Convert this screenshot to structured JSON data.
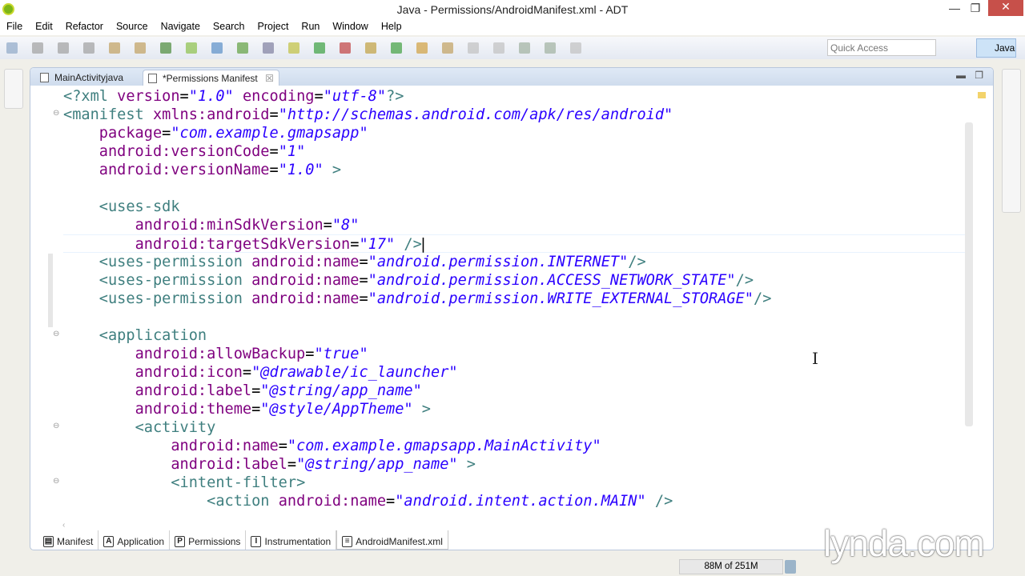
{
  "window": {
    "title": "Java - Permissions/AndroidManifest.xml - ADT",
    "minimize": "—",
    "restore": "❐",
    "close": "✕"
  },
  "menu": [
    "File",
    "Edit",
    "Refactor",
    "Source",
    "Navigate",
    "Search",
    "Project",
    "Run",
    "Window",
    "Help"
  ],
  "quick_access": {
    "placeholder": "Quick Access"
  },
  "perspective": {
    "label": "Java"
  },
  "editor_tabs": [
    {
      "label": "MainActivityjava",
      "active": false
    },
    {
      "label": "*Permissions Manifest",
      "active": true,
      "close": "☒"
    }
  ],
  "code_lines": [
    {
      "indent": 0,
      "segs": [
        [
          "pi",
          "<?xml "
        ],
        [
          "a",
          "version"
        ],
        [
          "p",
          "="
        ],
        [
          "v",
          "\"1.0\""
        ],
        [
          "p",
          " "
        ],
        [
          "a",
          "encoding"
        ],
        [
          "p",
          "="
        ],
        [
          "v",
          "\"utf-8\""
        ],
        [
          "pi",
          "?>"
        ]
      ]
    },
    {
      "indent": 0,
      "fold": true,
      "segs": [
        [
          "t",
          "<manifest "
        ],
        [
          "a",
          "xmlns:android"
        ],
        [
          "p",
          "="
        ],
        [
          "v",
          "\"http://schemas.android.com/apk/res/android\""
        ]
      ]
    },
    {
      "indent": 1,
      "segs": [
        [
          "a",
          "package"
        ],
        [
          "p",
          "="
        ],
        [
          "v",
          "\"com.example.gmapsapp\""
        ]
      ]
    },
    {
      "indent": 1,
      "segs": [
        [
          "a",
          "android:versionCode"
        ],
        [
          "p",
          "="
        ],
        [
          "v",
          "\"1\""
        ]
      ]
    },
    {
      "indent": 1,
      "segs": [
        [
          "a",
          "android:versionName"
        ],
        [
          "p",
          "="
        ],
        [
          "v",
          "\"1.0\""
        ],
        [
          "t",
          " >"
        ]
      ]
    },
    {
      "indent": 0,
      "segs": []
    },
    {
      "indent": 1,
      "segs": [
        [
          "t",
          "<uses-sdk"
        ]
      ]
    },
    {
      "indent": 2,
      "segs": [
        [
          "a",
          "android:minSdkVersion"
        ],
        [
          "p",
          "="
        ],
        [
          "v",
          "\"8\""
        ]
      ]
    },
    {
      "indent": 2,
      "current": true,
      "segs": [
        [
          "a",
          "android:targetSdkVersion"
        ],
        [
          "p",
          "="
        ],
        [
          "v",
          "\"17\""
        ],
        [
          "t",
          " />"
        ]
      ]
    },
    {
      "indent": 1,
      "segs": [
        [
          "t",
          "<uses-permission "
        ],
        [
          "a",
          "android:name"
        ],
        [
          "p",
          "="
        ],
        [
          "v",
          "\"android.permission.INTERNET\""
        ],
        [
          "t",
          "/>"
        ]
      ]
    },
    {
      "indent": 1,
      "segs": [
        [
          "t",
          "<uses-permission "
        ],
        [
          "a",
          "android:name"
        ],
        [
          "p",
          "="
        ],
        [
          "v",
          "\"android.permission.ACCESS_NETWORK_STATE\""
        ],
        [
          "t",
          "/>"
        ]
      ]
    },
    {
      "indent": 1,
      "segs": [
        [
          "t",
          "<uses-permission "
        ],
        [
          "a",
          "android:name"
        ],
        [
          "p",
          "="
        ],
        [
          "v",
          "\"android.permission.WRITE_EXTERNAL_STORAGE\""
        ],
        [
          "t",
          "/>"
        ]
      ]
    },
    {
      "indent": 0,
      "segs": []
    },
    {
      "indent": 1,
      "fold": true,
      "segs": [
        [
          "t",
          "<application"
        ]
      ]
    },
    {
      "indent": 2,
      "segs": [
        [
          "a",
          "android:allowBackup"
        ],
        [
          "p",
          "="
        ],
        [
          "v",
          "\"true\""
        ]
      ]
    },
    {
      "indent": 2,
      "segs": [
        [
          "a",
          "android:icon"
        ],
        [
          "p",
          "="
        ],
        [
          "v",
          "\"@drawable/ic_launcher\""
        ]
      ]
    },
    {
      "indent": 2,
      "segs": [
        [
          "a",
          "android:label"
        ],
        [
          "p",
          "="
        ],
        [
          "v",
          "\"@string/app_name\""
        ]
      ]
    },
    {
      "indent": 2,
      "segs": [
        [
          "a",
          "android:theme"
        ],
        [
          "p",
          "="
        ],
        [
          "v",
          "\"@style/AppTheme\""
        ],
        [
          "t",
          " >"
        ]
      ]
    },
    {
      "indent": 2,
      "fold": true,
      "segs": [
        [
          "t",
          "<activity"
        ]
      ]
    },
    {
      "indent": 3,
      "segs": [
        [
          "a",
          "android:name"
        ],
        [
          "p",
          "="
        ],
        [
          "v",
          "\"com.example.gmapsapp.MainActivity\""
        ]
      ]
    },
    {
      "indent": 3,
      "segs": [
        [
          "a",
          "android:label"
        ],
        [
          "p",
          "="
        ],
        [
          "v",
          "\"@string/app_name\""
        ],
        [
          "t",
          " >"
        ]
      ]
    },
    {
      "indent": 3,
      "fold": true,
      "segs": [
        [
          "t",
          "<intent-filter>"
        ]
      ]
    },
    {
      "indent": 4,
      "segs": [
        [
          "t",
          "<action "
        ],
        [
          "a",
          "android:name"
        ],
        [
          "p",
          "="
        ],
        [
          "v",
          "\"android.intent.action.MAIN\""
        ],
        [
          "t",
          " />"
        ]
      ]
    }
  ],
  "bottom_tabs": [
    {
      "icon": "▤",
      "label": "Manifest"
    },
    {
      "icon": "A",
      "label": "Application"
    },
    {
      "icon": "P",
      "label": "Permissions"
    },
    {
      "icon": "I",
      "label": "Instrumentation"
    },
    {
      "icon": "≡",
      "label": "AndroidManifest.xml",
      "active": true
    }
  ],
  "status": {
    "heap": "88M of 251M"
  },
  "watermark": "lynda.com"
}
